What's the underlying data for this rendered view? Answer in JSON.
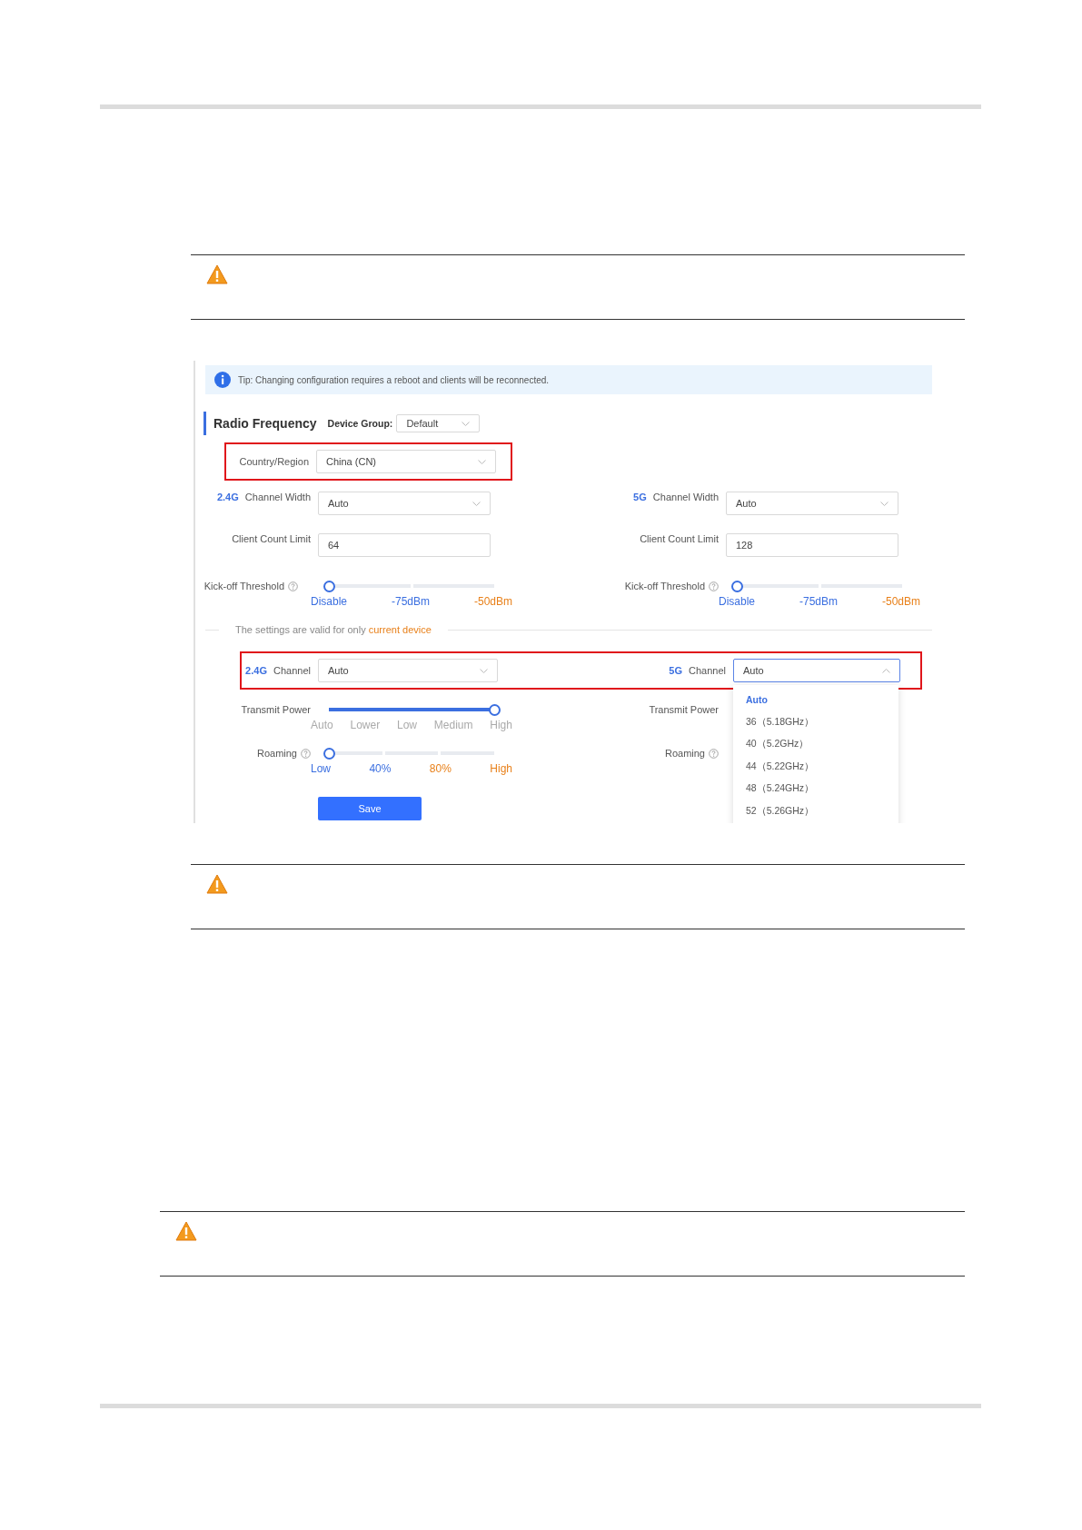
{
  "tip": "Tip: Changing configuration requires a reboot and clients will be reconnected.",
  "section_title": "Radio Frequency",
  "device_group": {
    "label": "Device Group:",
    "value": "Default"
  },
  "country": {
    "label": "Country/Region",
    "value": "China (CN)"
  },
  "bands": [
    {
      "band": "2.4G",
      "width_label": "Channel Width",
      "width_value": "Auto",
      "client_label": "Client Count Limit",
      "client_value": "64",
      "kickoff": {
        "label": "Kick-off Threshold",
        "level": 0,
        "marks": [
          {
            "label": "Disable",
            "color": "#3b6fe0"
          },
          {
            "label": "-75dBm",
            "color": "#3b6fe0"
          },
          {
            "label": "-50dBm",
            "color": "#e8801a"
          }
        ]
      }
    },
    {
      "band": "5G",
      "width_label": "Channel Width",
      "width_value": "Auto",
      "client_label": "Client Count Limit",
      "client_value": "128",
      "kickoff": {
        "label": "Kick-off Threshold",
        "level": 0,
        "marks": [
          {
            "label": "Disable",
            "color": "#3b6fe0"
          },
          {
            "label": "-75dBm",
            "color": "#3b6fe0"
          },
          {
            "label": "-50dBm",
            "color": "#e8801a"
          }
        ]
      }
    }
  ],
  "scope_note": {
    "text": "The settings are valid for only",
    "highlight": "current device"
  },
  "channels": [
    {
      "band": "2.4G",
      "label": "Channel",
      "value": "Auto",
      "expanded": false
    },
    {
      "band": "5G",
      "label": "Channel",
      "value": "Auto",
      "expanded": true,
      "options": [
        {
          "label": "Auto",
          "selected": true
        },
        {
          "label": "36（5.18GHz）",
          "selected": false
        },
        {
          "label": "40（5.2GHz）",
          "selected": false
        },
        {
          "label": "44（5.22GHz）",
          "selected": false
        },
        {
          "label": "48（5.24GHz）",
          "selected": false
        },
        {
          "label": "52（5.26GHz）",
          "selected": false
        }
      ]
    }
  ],
  "transmit_power": [
    {
      "label": "Transmit Power",
      "level": 1,
      "marks": [
        {
          "label": "Auto",
          "color": "#aaaaaa"
        },
        {
          "label": "Lower",
          "color": "#aaaaaa"
        },
        {
          "label": "Low",
          "color": "#aaaaaa"
        },
        {
          "label": "Medium",
          "color": "#aaaaaa"
        },
        {
          "label": "High",
          "color": "#aaaaaa"
        }
      ]
    },
    {
      "label": "Transmit Power"
    }
  ],
  "roaming": [
    {
      "label": "Roaming",
      "level": 0,
      "marks": [
        {
          "label": "Low",
          "color": "#3b6fe0"
        },
        {
          "label": "40%",
          "color": "#3b6fe0"
        },
        {
          "label": "80%",
          "color": "#e8801a"
        },
        {
          "label": "High",
          "color": "#e8801a"
        }
      ]
    },
    {
      "label": "Roaming"
    }
  ],
  "save_button": "Save"
}
